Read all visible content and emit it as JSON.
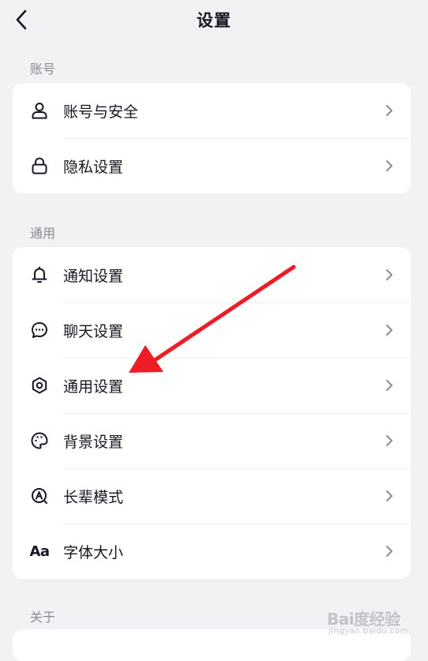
{
  "header": {
    "title": "设置"
  },
  "sections": [
    {
      "label": "账号",
      "items": [
        {
          "label": "账号与安全",
          "icon": "user-icon"
        },
        {
          "label": "隐私设置",
          "icon": "lock-icon"
        }
      ]
    },
    {
      "label": "通用",
      "items": [
        {
          "label": "通知设置",
          "icon": "bell-icon"
        },
        {
          "label": "聊天设置",
          "icon": "chat-bubble-icon"
        },
        {
          "label": "通用设置",
          "icon": "gear-icon"
        },
        {
          "label": "背景设置",
          "icon": "palette-icon"
        },
        {
          "label": "长辈模式",
          "icon": "elder-mode-icon"
        },
        {
          "label": "字体大小",
          "icon": "font-size-icon",
          "icon_text": "Aa"
        }
      ]
    },
    {
      "label": "关于",
      "items": []
    }
  ],
  "watermark": {
    "brand": "Bai度经验",
    "url": "jingyan.baidu.com"
  },
  "colors": {
    "background": "#f2f2f4",
    "card": "#ffffff",
    "text": "#161823",
    "section_label": "#8a8b91",
    "chevron": "#8a8b91",
    "annotation_arrow": "#ee1c25"
  }
}
